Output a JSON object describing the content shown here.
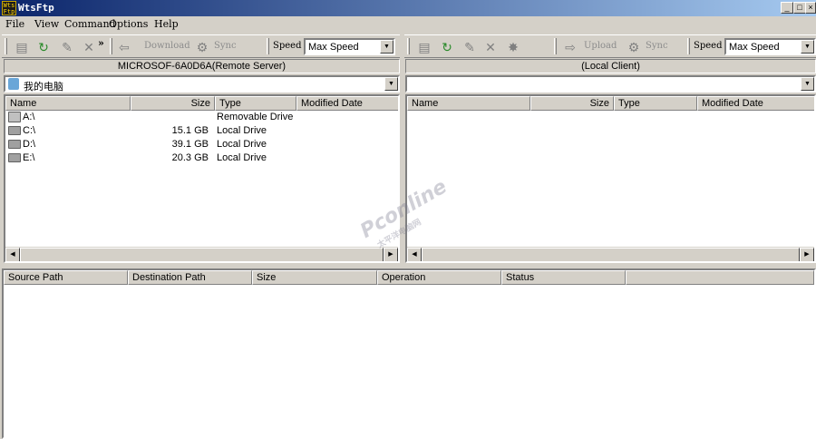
{
  "window": {
    "title": "WtsFtp",
    "icon": "wtsftp-logo-icon",
    "minimize": "_",
    "maximize": "□",
    "close": "×"
  },
  "menu": [
    "File",
    "View",
    "Command",
    "Options",
    "Help"
  ],
  "remote_toolbar": {
    "icons": [
      "open-folder-icon",
      "refresh-icon",
      "edit-icon",
      "delete-icon"
    ],
    "more": "»",
    "download_label": "Download",
    "sync_label": "Sync",
    "speed_label": "Speed",
    "speed_value": "Max Speed"
  },
  "local_toolbar": {
    "icons": [
      "open-folder-icon",
      "refresh-icon",
      "edit-icon",
      "delete-icon",
      "new-folder-icon"
    ],
    "upload_label": "Upload",
    "sync_label": "Sync",
    "speed_label": "Speed",
    "speed_value": "Max Speed"
  },
  "remote_panel": {
    "caption": "MICROSOF-6A0D6A(Remote Server)",
    "path": "我的电脑",
    "columns": [
      "Name",
      "Size",
      "Type",
      "Modified Date"
    ],
    "rows": [
      {
        "icon": "removable-drive-icon",
        "name": "A:\\",
        "size": "",
        "type": "Removable Drive",
        "date": ""
      },
      {
        "icon": "local-drive-icon",
        "name": "C:\\",
        "size": "15.1 GB",
        "type": "Local Drive",
        "date": ""
      },
      {
        "icon": "local-drive-icon",
        "name": "D:\\",
        "size": "39.1 GB",
        "type": "Local Drive",
        "date": ""
      },
      {
        "icon": "local-drive-icon",
        "name": "E:\\",
        "size": "20.3 GB",
        "type": "Local Drive",
        "date": ""
      }
    ]
  },
  "local_panel": {
    "caption": "(Local Client)",
    "path": "",
    "columns": [
      "Name",
      "Size",
      "Type",
      "Modified Date"
    ],
    "rows": []
  },
  "queue": {
    "columns": [
      "Source Path",
      "Destination Path",
      "Size",
      "Operation",
      "Status"
    ]
  },
  "watermark": {
    "line1": "Pconline",
    "line2": "太平洋电脑网"
  },
  "colors": {
    "titlebar_start": "#0a246a",
    "titlebar_end": "#a6caf0",
    "chrome": "#d4d0c8",
    "disabled_text": "#8c8c8c"
  }
}
